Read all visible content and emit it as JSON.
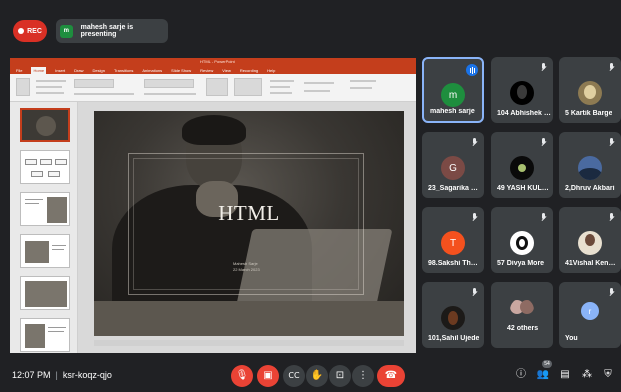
{
  "recording": {
    "label": "REC"
  },
  "presenter": {
    "initial": "m",
    "text": "mahesh sarje is presenting"
  },
  "slideshow": {
    "window_title": "HTML - PowerPoint",
    "tabs": [
      "File",
      "Home",
      "Insert",
      "Draw",
      "Design",
      "Transitions",
      "Animations",
      "Slide Show",
      "Review",
      "View",
      "Recording",
      "Help"
    ],
    "slide_title": "HTML",
    "slide_subtitle_lines": [
      "Mahesh Sarje",
      "22 March 2023"
    ]
  },
  "participants": [
    {
      "name": "mahesh sarje",
      "initial": "m",
      "avatar_color": "#1e8e3e",
      "speaking": true,
      "muted": false
    },
    {
      "name": "104 Abhishek W...",
      "initial": "",
      "avatar_color": "#000000",
      "speaking": false,
      "muted": true
    },
    {
      "name": "5 Kartik Barge",
      "initial": "",
      "avatar_color": "#8d7a52",
      "speaking": false,
      "muted": true
    },
    {
      "name": "23_Sagarika Gai...",
      "initial": "G",
      "avatar_color": "#7b4a45",
      "speaking": false,
      "muted": true
    },
    {
      "name": "49 YASH KULKA...",
      "initial": "",
      "avatar_color": "#0a0a0a",
      "speaking": false,
      "muted": true
    },
    {
      "name": "2,Dhruv Akbari",
      "initial": "",
      "avatar_color": "#4a6aa0",
      "speaking": false,
      "muted": true
    },
    {
      "name": "98.Sakshi Thorat",
      "initial": "T",
      "avatar_color": "#f4511e",
      "speaking": false,
      "muted": true
    },
    {
      "name": "57 Divya More",
      "initial": "",
      "avatar_color": "#ffffff",
      "speaking": false,
      "muted": true
    },
    {
      "name": "41Vishal Kendre",
      "initial": "",
      "avatar_color": "#e8e0d0",
      "speaking": false,
      "muted": true
    },
    {
      "name": "101,Sahil Ujede",
      "initial": "",
      "avatar_color": "#1c1a18",
      "speaking": false,
      "muted": true
    },
    {
      "name": "42 others",
      "initial": "",
      "avatar_color": "#c9a7a0",
      "speaking": false,
      "muted": false
    },
    {
      "name": "You",
      "initial": "r",
      "avatar_color": "#8ab4f8",
      "speaking": false,
      "muted": true
    }
  ],
  "footer": {
    "time": "12:07 PM",
    "separator": "|",
    "meeting_code": "ksr-koqz-qjo",
    "participant_count": "54"
  },
  "controls": {
    "mic_icon": "mic-off-icon",
    "camera_icon": "camera-off-icon",
    "captions_icon": "captions-icon",
    "raise_hand_icon": "raise-hand-icon",
    "present_icon": "present-now-icon",
    "more_icon": "more-options-icon",
    "end_call_icon": "end-call-icon",
    "info_icon": "info-icon",
    "people_icon": "people-icon",
    "chat_icon": "chat-icon",
    "activities_icon": "activities-icon",
    "host_icon": "host-controls-icon"
  },
  "colors": {
    "background": "#202124",
    "tile": "#3c4043",
    "red": "#ea4335",
    "powerpoint": "#c43e1c",
    "speaking_border": "#8ab4f8"
  }
}
